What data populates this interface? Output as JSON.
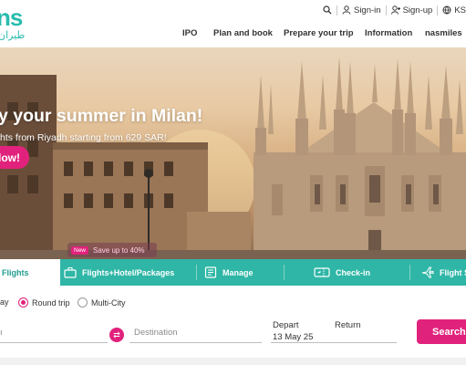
{
  "brand": {
    "logo_latin": "ns",
    "logo_arabic": "طيران"
  },
  "utility": {
    "signin": "Sign-in",
    "signup": "Sign-up",
    "lang": "KS"
  },
  "nav": [
    "IPO",
    "Plan and book",
    "Prepare your trip",
    "Information",
    "nasmiles"
  ],
  "hero": {
    "title": "y your summer in Milan!",
    "subtitle": "hts from Riyadh starting from 629 SAR!",
    "cta": "low!"
  },
  "promo": {
    "badge": "New",
    "text": "Save up to 40%"
  },
  "tabs": [
    "Flights",
    "Flights+Hotel/Packages",
    "Manage",
    "Check-in",
    "Flight St"
  ],
  "trip_types": {
    "one_way": "ay",
    "round_trip": "Round trip",
    "multi_city": "Multi-City",
    "selected": "Round trip"
  },
  "form": {
    "origin_placeholder": "ı",
    "destination_placeholder": "Destination",
    "depart_label": "Depart",
    "return_label": "Return",
    "depart_value": "13 May 25",
    "search": "Search"
  },
  "colors": {
    "brand_teal": "#28bcae",
    "tab_teal": "#2fb6a6",
    "accent_pink": "#e1227c"
  },
  "icons": {
    "search": "search-icon",
    "signin": "user-icon",
    "signup": "user-add-icon",
    "lang": "globe-icon",
    "swap": "swap-icon"
  }
}
